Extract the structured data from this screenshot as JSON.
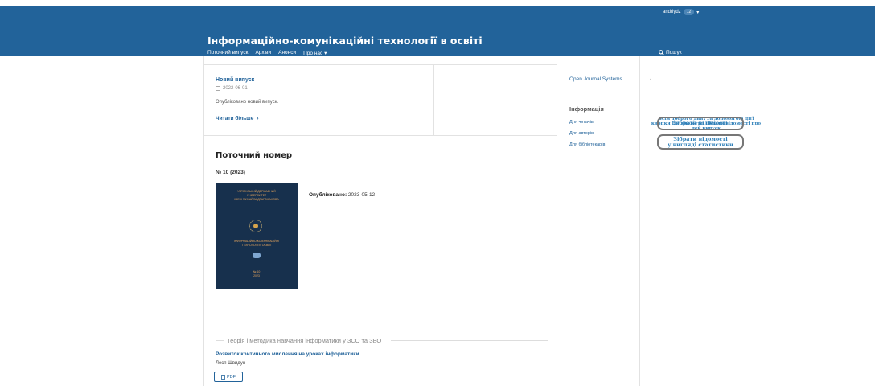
{
  "header": {
    "username": "andriydz",
    "notification_count": "12",
    "user_caret": "▾",
    "site_title": "Інформаційно-комунікаційні технології в освіті",
    "nav": [
      "Поточний випуск",
      "Архіви",
      "Анонси",
      "Про нас ▾"
    ],
    "search_label": "Пошук",
    "color": "#22639a"
  },
  "announcement": {
    "title": "Новий випуск",
    "date": "2022-06-01",
    "body": "Опубліковано новий випуск.",
    "read_more": "Читати більше",
    "read_more_icon": "›"
  },
  "current_issue": {
    "heading": "Поточний номер",
    "issue": "№ 10 (2023)",
    "published_label": "Опубліковано:",
    "published_date": "2023-05-12",
    "cover_lines": [
      "УКРАЇНСЬКИЙ ДЕРЖАВНИЙ",
      "УНІВЕРСИТЕТ",
      "ІМЕНІ МИХАЙЛА ДРАГОМАНОВА",
      "ІНФОРМАЦІЙНО-КОМУНІКАЦІЙНІ",
      "ТЕХНОЛОГІЇ В ОСВІТІ",
      "№ 10",
      "2023"
    ]
  },
  "section": {
    "title": "Теорія і методика навчання інформатики у ЗСО та ЗВО",
    "article_title": "Розвиток критичного мислення на уроках інформатики",
    "author": "Леся Швидун",
    "pdf_label": "PDF"
  },
  "sidebar": {
    "ojs_link": "Open Journal Systems",
    "info_title": "Інформація",
    "links": [
      "Для читачів",
      "Для авторів",
      "Для бібліотекарів"
    ]
  },
  "widget": {
    "text": "Всім доброго дня! За допомогою цієї кнопки Ви зможете зібрати відомості про цей випуск",
    "button1": "Зібрати відомості",
    "button2_line1": "Зібрати відомості",
    "button2_line2": "у вигляді статистики"
  }
}
